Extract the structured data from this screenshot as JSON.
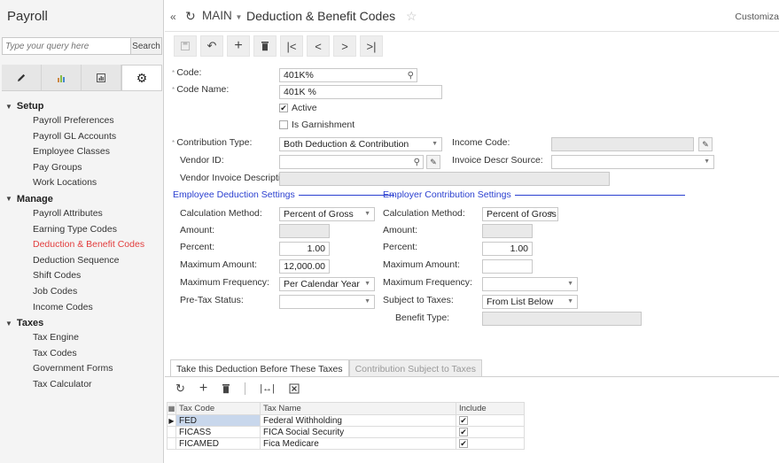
{
  "sidebar": {
    "title": "Payroll",
    "search_placeholder": "Type your query here",
    "search_button": "Search",
    "sections": [
      {
        "label": "Setup",
        "items": [
          "Payroll Preferences",
          "Payroll GL Accounts",
          "Employee Classes",
          "Pay Groups",
          "Work Locations"
        ]
      },
      {
        "label": "Manage",
        "items": [
          "Payroll Attributes",
          "Earning Type Codes",
          "Deduction & Benefit Codes",
          "Deduction Sequence",
          "Shift Codes",
          "Job Codes",
          "Income Codes"
        ]
      },
      {
        "label": "Taxes",
        "items": [
          "Tax Engine",
          "Tax Codes",
          "Government Forms",
          "Tax Calculator"
        ]
      }
    ],
    "active_item": "Deduction & Benefit Codes"
  },
  "header": {
    "screen": "MAIN",
    "title": "Deduction & Benefit Codes",
    "customize": "Customiza"
  },
  "form": {
    "code_label": "Code:",
    "code_value": "401K%",
    "code_name_label": "Code Name:",
    "code_name_value": "401K %",
    "active_label": "Active",
    "is_garnishment_label": "Is Garnishment",
    "contribution_type_label": "Contribution Type:",
    "contribution_type_value": "Both Deduction & Contribution",
    "income_code_label": "Income Code:",
    "vendor_id_label": "Vendor ID:",
    "invoice_descr_source_label": "Invoice Descr Source:",
    "vendor_invoice_desc_label": "Vendor Invoice Description:"
  },
  "employee": {
    "group_title": "Employee Deduction Settings",
    "calc_method_label": "Calculation Method:",
    "calc_method_value": "Percent of Gross",
    "amount_label": "Amount:",
    "percent_label": "Percent:",
    "percent_value": "1.00",
    "max_amount_label": "Maximum Amount:",
    "max_amount_value": "12,000.00",
    "max_freq_label": "Maximum Frequency:",
    "max_freq_value": "Per Calendar Year",
    "pretax_label": "Pre-Tax Status:"
  },
  "employer": {
    "group_title": "Employer Contribution Settings",
    "calc_method_label": "Calculation Method:",
    "calc_method_value": "Percent of Gross",
    "amount_label": "Amount:",
    "percent_label": "Percent:",
    "percent_value": "1.00",
    "max_amount_label": "Maximum Amount:",
    "max_freq_label": "Maximum Frequency:",
    "subject_label": "Subject to Taxes:",
    "subject_value": "From List Below",
    "benefit_type_label": "Benefit Type:"
  },
  "tabs": {
    "active": "Take this Deduction Before These Taxes",
    "inactive": "Contribution Subject to Taxes"
  },
  "grid": {
    "headers": [
      "Tax Code",
      "Tax Name",
      "Include"
    ],
    "rows": [
      {
        "code": "FED",
        "name": "Federal Withholding",
        "include": true
      },
      {
        "code": "FICASS",
        "name": "FICA Social Security",
        "include": true
      },
      {
        "code": "FICAMED",
        "name": "Fica Medicare",
        "include": true
      }
    ]
  }
}
